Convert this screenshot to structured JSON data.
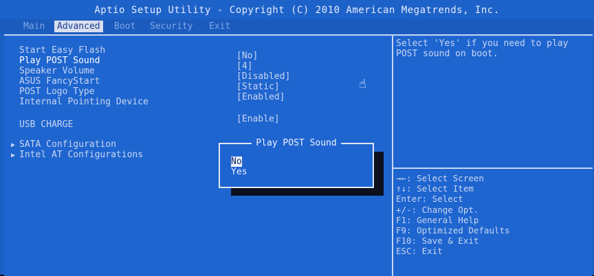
{
  "title": "Aptio Setup Utility - Copyright (C) 2010 American Megatrends, Inc.",
  "tabs": [
    "Main",
    "Advanced",
    "Boot",
    "Security",
    "Exit"
  ],
  "active_tab": "Advanced",
  "settings": [
    {
      "label": "Start Easy Flash",
      "value": ""
    },
    {
      "label": "Play POST Sound",
      "value": "[No]"
    },
    {
      "label": "Speaker Volume",
      "value": "[4]"
    },
    {
      "label": "ASUS FancyStart",
      "value": "[Disabled]"
    },
    {
      "label": "POST Logo Type",
      "value": "[Static]"
    },
    {
      "label": "Internal Pointing Device",
      "value": "[Enabled]"
    },
    {
      "label": "USB CHARGE",
      "value": "[Enable]"
    }
  ],
  "submenus": [
    "SATA Configuration",
    "Intel AT Configurations"
  ],
  "help_text": "Select 'Yes' if you need to play POST sound on boot.",
  "key_help": [
    "→←: Select Screen",
    "↑↓: Select Item",
    "Enter: Select",
    "+/-: Change Opt.",
    "F1: General Help",
    "F9: Optimized Defaults",
    "F10: Save & Exit",
    "ESC: Exit"
  ],
  "popup": {
    "title": "Play POST Sound",
    "options": [
      "No",
      "Yes"
    ],
    "selected": "No"
  },
  "colors": {
    "background": "#1c5fc4",
    "text": "#c9d3ee",
    "highlight": "#eef2ff"
  }
}
